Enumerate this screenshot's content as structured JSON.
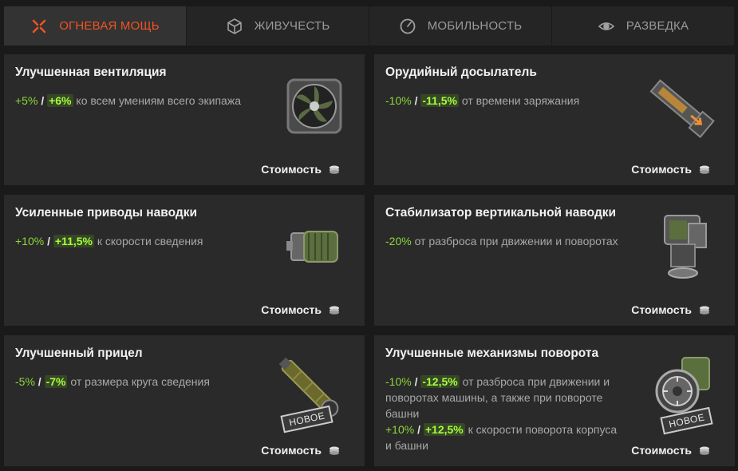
{
  "tabs": [
    {
      "label": "ОГНЕВАЯ МОЩЬ",
      "icon": "crosshair-x-icon"
    },
    {
      "label": "ЖИВУЧЕСТЬ",
      "icon": "hexagon-cube-icon"
    },
    {
      "label": "МОБИЛЬНОСТЬ",
      "icon": "speedometer-icon"
    },
    {
      "label": "РАЗВЕДКА",
      "icon": "eye-icon"
    }
  ],
  "cost_label": "Стоимость",
  "new_badge": "НОВОЕ",
  "colors": {
    "accent": "#f25322",
    "bonus": "#8fd63a",
    "bonus_strong": "#a5ff3a"
  },
  "cards": [
    {
      "title": "Улучшенная вентиляция",
      "v1": "+5%",
      "v2": "+6%",
      "text": "ко всем умениям всего экипажа",
      "image": "ventilation-icon"
    },
    {
      "title": "Орудийный досылатель",
      "v1": "-10%",
      "v2": "-11,5%",
      "text": "от времени заряжания",
      "image": "rammer-icon"
    },
    {
      "title": "Усиленные приводы наводки",
      "v1": "+10%",
      "v2": "+11,5%",
      "text": "к скорости сведения",
      "image": "aiming-drive-icon"
    },
    {
      "title": "Стабилизатор вертикальной наводки",
      "v1": "-20%",
      "text": "от разброса при движении и поворотах",
      "image": "stabilizer-icon"
    },
    {
      "title": "Улучшенный прицел",
      "v1": "-5%",
      "v2": "-7%",
      "text": "от размера круга сведения",
      "image": "sight-icon"
    },
    {
      "title": "Улучшенные механизмы поворота",
      "v1": "-10%",
      "v2": "-12,5%",
      "text": "от разброса при движении и поворотах машины, а также при повороте башни",
      "v3": "+10%",
      "v4": "+12,5%",
      "text2": "к скорости поворота корпуса и башни",
      "image": "turning-mechanism-icon"
    }
  ]
}
